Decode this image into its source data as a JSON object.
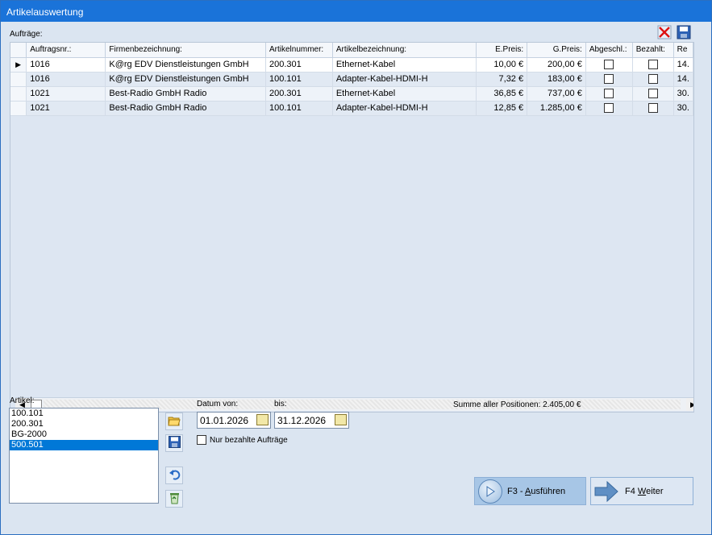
{
  "window": {
    "title": "Artikelauswertung"
  },
  "orders_label": "Aufträge:",
  "grid": {
    "columns": [
      "Auftragsnr.:",
      "Firmenbezeichnung:",
      "Artikelnummer:",
      "Artikelbezeichnung:",
      "E.Preis:",
      "G.Preis:",
      "Abgeschl.:",
      "Bezahlt:",
      "Re"
    ],
    "rows": [
      {
        "nr": "1016",
        "firma": "K@rg EDV Dienstleistungen GmbH",
        "artnr": "200.301",
        "bez": "Ethernet-Kabel",
        "epreis": "10,00 €",
        "gpreis": "200,00 €",
        "abgeschl": false,
        "bezahlt": false,
        "re": "14.",
        "selected": true
      },
      {
        "nr": "1016",
        "firma": "K@rg EDV Dienstleistungen GmbH",
        "artnr": "100.101",
        "bez": "Adapter-Kabel-HDMI-H",
        "epreis": "7,32 €",
        "gpreis": "183,00 €",
        "abgeschl": false,
        "bezahlt": false,
        "re": "14.",
        "selected": false
      },
      {
        "nr": "1021",
        "firma": "Best-Radio GmbH Radio",
        "artnr": "200.301",
        "bez": "Ethernet-Kabel",
        "epreis": "36,85 €",
        "gpreis": "737,00 €",
        "abgeschl": false,
        "bezahlt": false,
        "re": "30.",
        "selected": false
      },
      {
        "nr": "1021",
        "firma": "Best-Radio GmbH Radio",
        "artnr": "100.101",
        "bez": "Adapter-Kabel-HDMI-H",
        "epreis": "12,85 €",
        "gpreis": "1.285,00 €",
        "abgeschl": false,
        "bezahlt": false,
        "re": "30.",
        "selected": false
      }
    ]
  },
  "articles": {
    "label": "Artikel:",
    "items": [
      "100.101",
      "200.301",
      "BG-2000",
      "500.501"
    ],
    "selected_index": 3
  },
  "date_from": {
    "label": "Datum von:",
    "value": "01.01.2026"
  },
  "date_to": {
    "label": "bis:",
    "value": "31.12.2026"
  },
  "only_paid": {
    "label": "Nur bezahlte Aufträge",
    "checked": false
  },
  "sum": {
    "text": "Summe aller Positionen: 2.405,00 €"
  },
  "buttons": {
    "execute_key": "F3 - ",
    "execute_mnemonic": "A",
    "execute_rest": "usführen",
    "next_key": "F4 ",
    "next_mnemonic": "W",
    "next_rest": "eiter"
  },
  "icons": {
    "delete": "delete-red-x-icon",
    "save": "save-disk-icon",
    "open": "open-folder-icon",
    "undo": "undo-arrow-icon",
    "recycle": "recycle-bin-icon",
    "calendar": "calendar-icon"
  }
}
